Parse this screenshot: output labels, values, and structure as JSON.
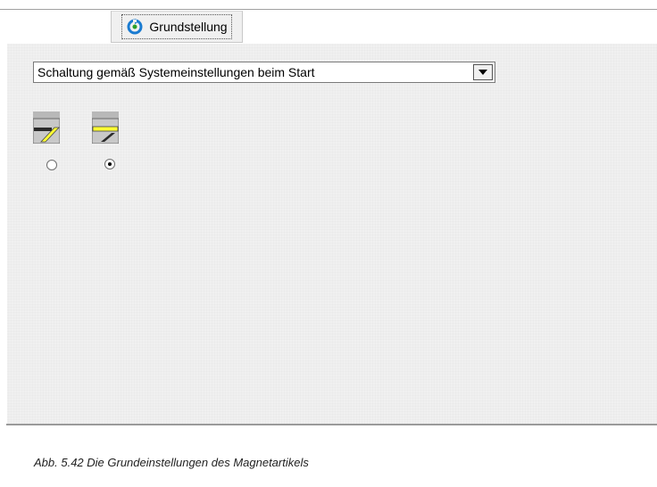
{
  "tab": {
    "label": "Grundstellung",
    "icon": "reset-icon"
  },
  "dropdown": {
    "value": "Schaltung gemäß Systemeinstellungen beim Start"
  },
  "options": [
    {
      "icon": "turnout-position-1-icon",
      "selected": false
    },
    {
      "icon": "turnout-position-2-icon",
      "selected": true
    }
  ],
  "caption": "Abb. 5.42    Die Grundeinstellungen des Magnetartikels",
  "colors": {
    "panel": "#f0f0f0",
    "highlight": "#ffff33",
    "track": "#2a2a2a",
    "icon_bg": "#b8b8b8"
  }
}
